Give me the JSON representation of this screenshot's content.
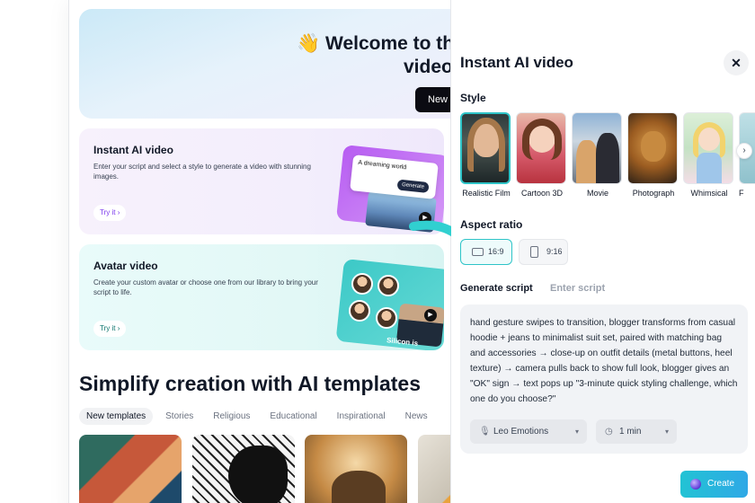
{
  "hero": {
    "emoji": "👋",
    "title_line1": "Welcome to the",
    "title_line2": "video m",
    "button_label": "New proj"
  },
  "cards": {
    "ai": {
      "title": "Instant AI video",
      "description": "Enter your script and select a style to generate a video with stunning images.",
      "try_label": "Try it",
      "prompt_text": "A dreaming world",
      "generate_label": "Generate"
    },
    "avatar": {
      "title": "Avatar video",
      "description": "Create your custom avatar or choose one from our library to bring your script to life.",
      "try_label": "Try it",
      "overlay_text": "Silicon is"
    }
  },
  "templates": {
    "title": "Simplify creation with AI templates",
    "tabs": [
      {
        "label": "New templates",
        "active": true
      },
      {
        "label": "Stories",
        "active": false
      },
      {
        "label": "Religious",
        "active": false
      },
      {
        "label": "Educational",
        "active": false
      },
      {
        "label": "Inspirational",
        "active": false
      },
      {
        "label": "News",
        "active": false
      }
    ]
  },
  "panel": {
    "title": "Instant AI video",
    "close_icon": "close-icon",
    "style_label": "Style",
    "styles": [
      {
        "label": "Realistic Film",
        "selected": true
      },
      {
        "label": "Cartoon 3D",
        "selected": false
      },
      {
        "label": "Movie",
        "selected": false
      },
      {
        "label": "Photograph",
        "selected": false
      },
      {
        "label": "Whimsical",
        "selected": false
      },
      {
        "label": "F",
        "selected": false
      }
    ],
    "aspect_label": "Aspect ratio",
    "ratios": [
      {
        "label": "16:9",
        "selected": true
      },
      {
        "label": "9:16",
        "selected": false
      }
    ],
    "tab_generate": "Generate script",
    "tab_enter": "Enter script",
    "script": "hand gesture swipes to transition, blogger transforms from casual hoodie + jeans to minimalist suit set, paired with matching bag and accessories → close-up on outfit details (metal buttons, heel texture) → camera pulls back to show full look, blogger gives an \"OK\" sign → text pops up \"3-minute quick styling challenge, which one do you choose?\"",
    "voice": "Leo Emotions",
    "duration": "1 min",
    "create_label": "Create"
  },
  "colors": {
    "accent": "#2ec4c8",
    "create_start": "#22c3d4",
    "create_end": "#2fa8e6",
    "dark_button": "#0b0b12"
  }
}
